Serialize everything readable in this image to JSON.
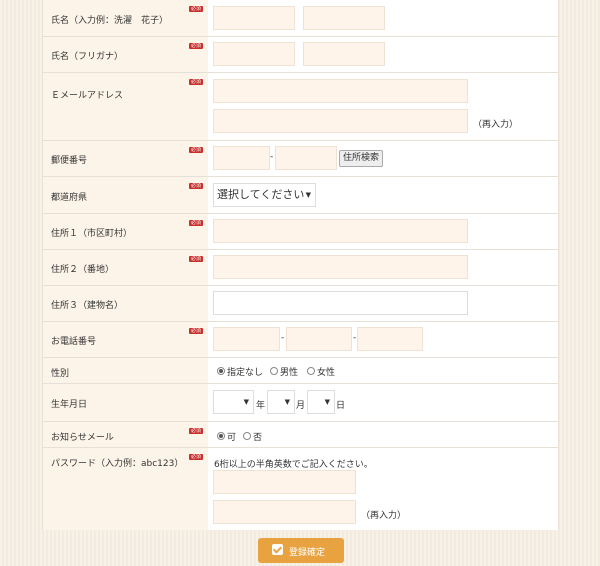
{
  "form": {
    "required_badge": "必須",
    "name": {
      "label": "氏名（入力例：洗濯　花子）"
    },
    "name_kana": {
      "label": "氏名（フリガナ）"
    },
    "email": {
      "label": "Ｅメールアドレス",
      "reenter": "（再入力）"
    },
    "postal": {
      "label": "郵便番号",
      "separator": "-",
      "search_button": "住所検索"
    },
    "prefecture": {
      "label": "都道府県",
      "selected": "選択してください"
    },
    "address1": {
      "label": "住所１（市区町村）"
    },
    "address2": {
      "label": "住所２（番地）"
    },
    "address3": {
      "label": "住所３（建物名）"
    },
    "phone": {
      "label": "お電話番号",
      "separator": "-"
    },
    "gender": {
      "label": "性別",
      "options": [
        "指定なし",
        "男性",
        "女性"
      ],
      "selected": "指定なし"
    },
    "birthdate": {
      "label": "生年月日",
      "year_unit": "年",
      "month_unit": "月",
      "day_unit": "日"
    },
    "newsletter": {
      "label": "お知らせメール",
      "options": [
        "可",
        "否"
      ],
      "selected": "可"
    },
    "password": {
      "label": "パスワード（入力例：abc123）",
      "hint": "6桁以上の半角英数でご記入ください。",
      "reenter": "（再入力）"
    },
    "submit_label": "登録確定"
  }
}
